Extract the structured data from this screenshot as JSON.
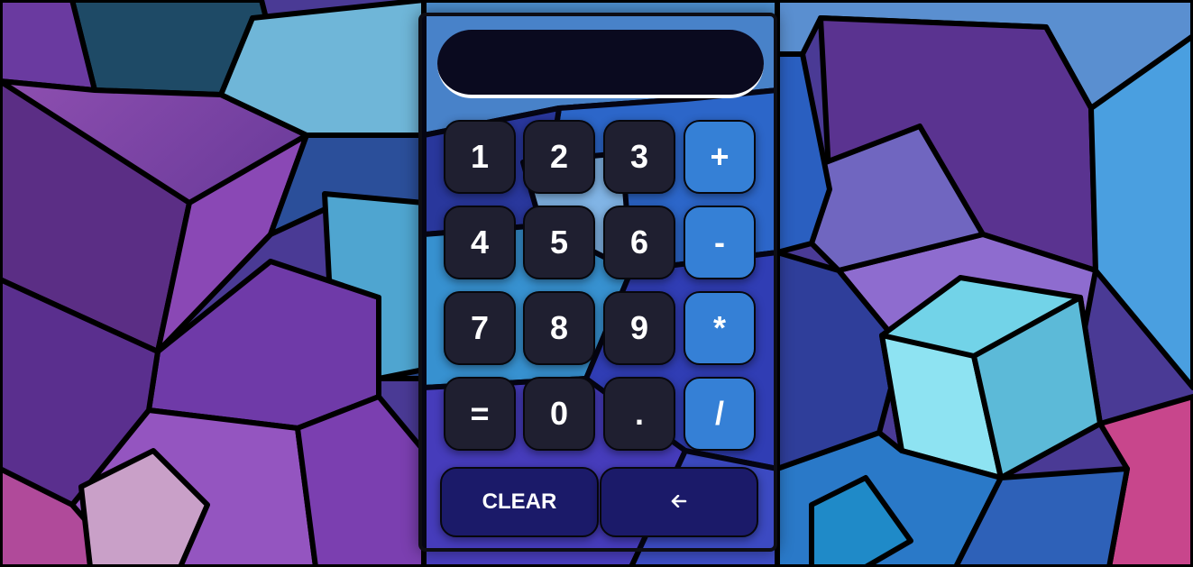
{
  "calculator": {
    "display_value": "",
    "keys": [
      {
        "label": "1",
        "kind": "num",
        "name": "key-1"
      },
      {
        "label": "2",
        "kind": "num",
        "name": "key-2"
      },
      {
        "label": "3",
        "kind": "num",
        "name": "key-3"
      },
      {
        "label": "+",
        "kind": "op",
        "name": "key-plus"
      },
      {
        "label": "4",
        "kind": "num",
        "name": "key-4"
      },
      {
        "label": "5",
        "kind": "num",
        "name": "key-5"
      },
      {
        "label": "6",
        "kind": "num",
        "name": "key-6"
      },
      {
        "label": "-",
        "kind": "op",
        "name": "key-minus"
      },
      {
        "label": "7",
        "kind": "num",
        "name": "key-7"
      },
      {
        "label": "8",
        "kind": "num",
        "name": "key-8"
      },
      {
        "label": "9",
        "kind": "num",
        "name": "key-9"
      },
      {
        "label": "*",
        "kind": "op",
        "name": "key-multiply"
      },
      {
        "label": "=",
        "kind": "num",
        "name": "key-equals"
      },
      {
        "label": "0",
        "kind": "num",
        "name": "key-0"
      },
      {
        "label": ".",
        "kind": "num",
        "name": "key-decimal"
      },
      {
        "label": "/",
        "kind": "op",
        "name": "key-divide"
      }
    ],
    "clear_label": "CLEAR",
    "backspace_icon": "arrow-left-icon",
    "colors": {
      "number_key": "#1f1f30",
      "operator_key": "#3580d6",
      "wide_key": "#1b1a69",
      "display_bg": "#0a0a1f"
    }
  },
  "background": {
    "description_icon": "cubes-wallpaper"
  }
}
